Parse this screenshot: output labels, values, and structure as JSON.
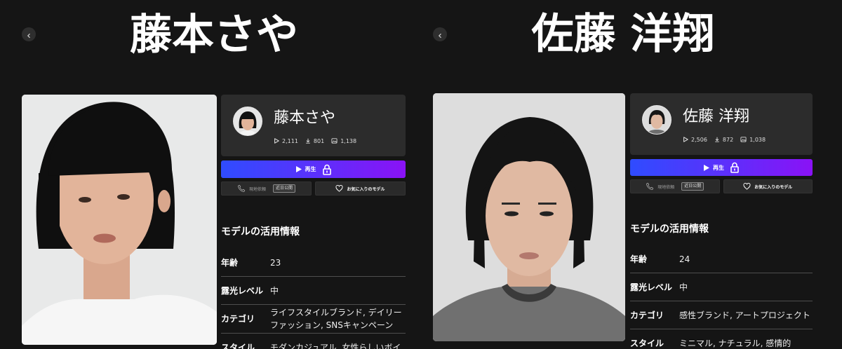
{
  "colors": {
    "background": "#151515",
    "card": "#2c2c2c",
    "accent_start": "#2f4cff",
    "accent_end": "#8a12f6",
    "divider": "#4e4e4e"
  },
  "icons": {
    "back": "chevron-left-icon",
    "plays": "play-count-icon",
    "downloads": "download-icon",
    "images": "image-icon",
    "play": "play-icon",
    "lock": "lock-icon",
    "request": "phone-icon",
    "favorite": "heart-icon"
  },
  "panels": [
    {
      "title": "藤本さや",
      "name": "藤本さや",
      "stats": {
        "plays": "2,111",
        "downloads": "801",
        "images": "1,138"
      },
      "play_label": "再生",
      "request_label": "現地依頼",
      "request_badge": "近日公開",
      "favorite_label": "お気に入りのモデル",
      "info_title": "モデルの活用情報",
      "info_rows": [
        {
          "label": "年齢",
          "value": "23"
        },
        {
          "label": "露光レベル",
          "value": "中"
        },
        {
          "label": "カテゴリ",
          "value": "ライフスタイルブランド, デイリーファッション, SNSキャンペーン"
        },
        {
          "label": "スタイル",
          "value": "モダンカジュアル, 女性らしいボイ"
        }
      ]
    },
    {
      "title": "佐藤 洋翔",
      "name": "佐藤 洋翔",
      "stats": {
        "plays": "2,506",
        "downloads": "872",
        "images": "1,038"
      },
      "play_label": "再生",
      "request_label": "現地依頼",
      "request_badge": "近日公開",
      "favorite_label": "お気に入りのモデル",
      "info_title": "モデルの活用情報",
      "info_rows": [
        {
          "label": "年齢",
          "value": "24"
        },
        {
          "label": "露光レベル",
          "value": "中"
        },
        {
          "label": "カテゴリ",
          "value": "感性ブランド, アートプロジェクト"
        },
        {
          "label": "スタイル",
          "value": "ミニマル, ナチュラル, 感情的"
        }
      ]
    }
  ]
}
